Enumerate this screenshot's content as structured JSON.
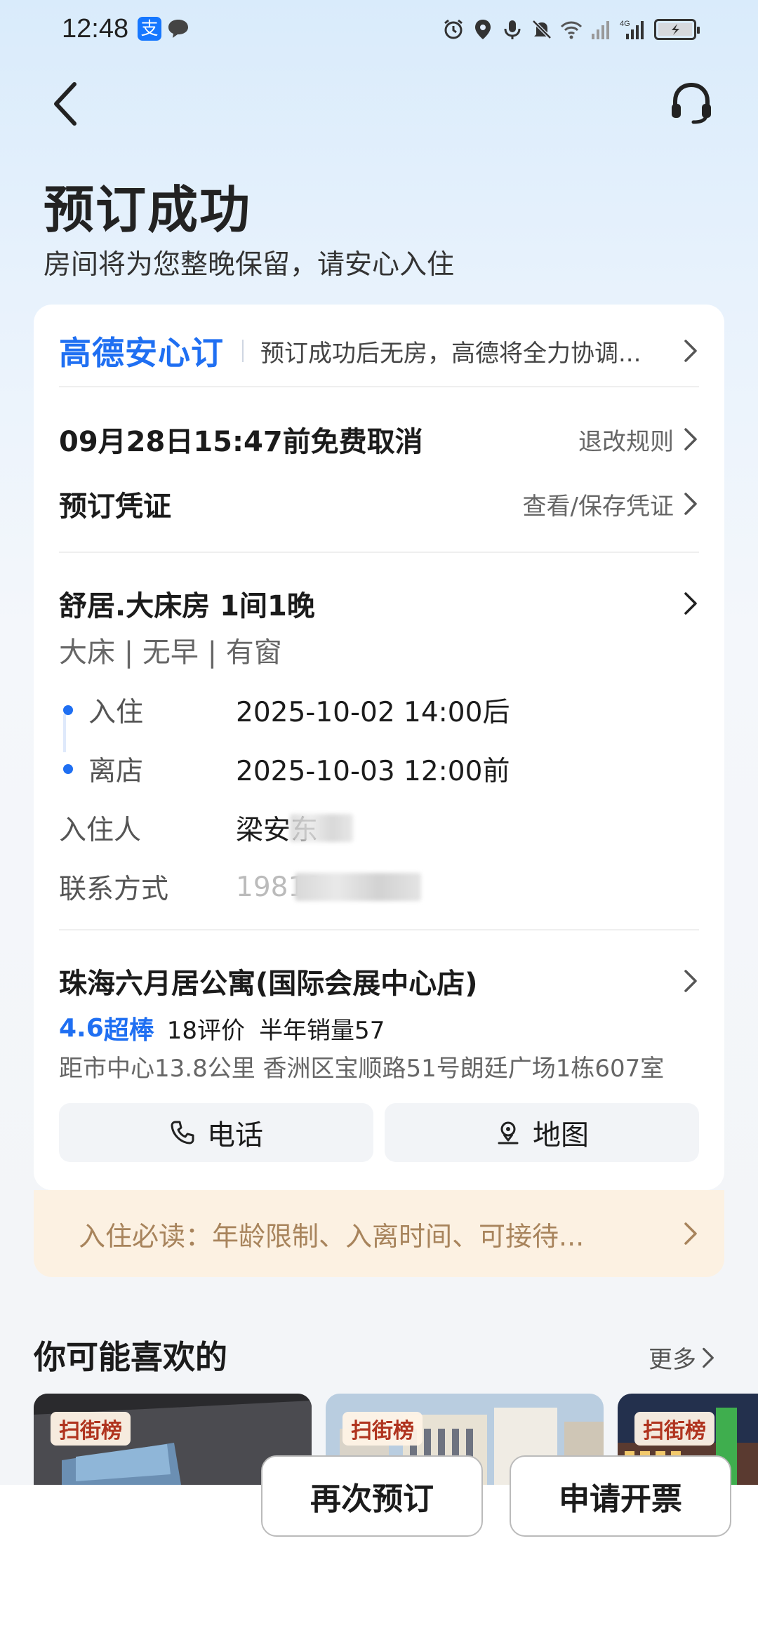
{
  "status_bar": {
    "time": "12:48",
    "app_icon_text": "支",
    "icons": [
      "alarm-icon",
      "location-icon",
      "mic-icon",
      "mute-icon",
      "wifi-icon",
      "signal-icon",
      "4g-signal-icon",
      "battery-icon"
    ],
    "network_label": "4G"
  },
  "header": {
    "back_icon": "chevron-left-icon",
    "service_icon": "headset-icon"
  },
  "title": "预订成功",
  "subtitle": "房间将为您整晚保留，请安心入住",
  "guarantee": {
    "brand": "高德安心订",
    "description": "预订成功后无房，高德将全力协调..."
  },
  "cancellation": {
    "text": "09月28日15:47前免费取消",
    "link": "退改规则"
  },
  "voucher": {
    "label": "预订凭证",
    "link": "查看/保存凭证"
  },
  "room": {
    "title": "舒居.大床房 1间1晚",
    "tags": "大床 | 无早 | 有窗",
    "check_in_label": "入住",
    "check_in_value": "2025-10-02 14:00后",
    "check_out_label": "离店",
    "check_out_value": "2025-10-03 12:00前",
    "guest_label": "入住人",
    "guest_value": "梁安东",
    "contact_label": "联系方式",
    "contact_value": "19812"
  },
  "hotel": {
    "name": "珠海六月居公寓(国际会展中心店)",
    "score": "4.6",
    "score_word": "超棒",
    "reviews": "18评价",
    "sales": "半年销量57",
    "address": "距市中心13.8公里  香洲区宝顺路51号朗廷广场1栋607室",
    "phone_button": "电话",
    "map_button": "地图"
  },
  "notice": {
    "text": "入住必读：年龄限制、入离时间、可接待..."
  },
  "recommend": {
    "title": "你可能喜欢的",
    "more": "更多",
    "badge": "扫街榜",
    "cards": [
      {
        "badge": "扫街榜"
      },
      {
        "badge": "扫街榜"
      },
      {
        "badge": "扫街榜"
      }
    ]
  },
  "bottom": {
    "rebook": "再次预订",
    "invoice": "申请开票"
  },
  "colors": {
    "accent": "#1f6ff2",
    "notice_bg": "#fcf1e2",
    "notice_text": "#a8845c",
    "badge_text": "#b0341f"
  }
}
